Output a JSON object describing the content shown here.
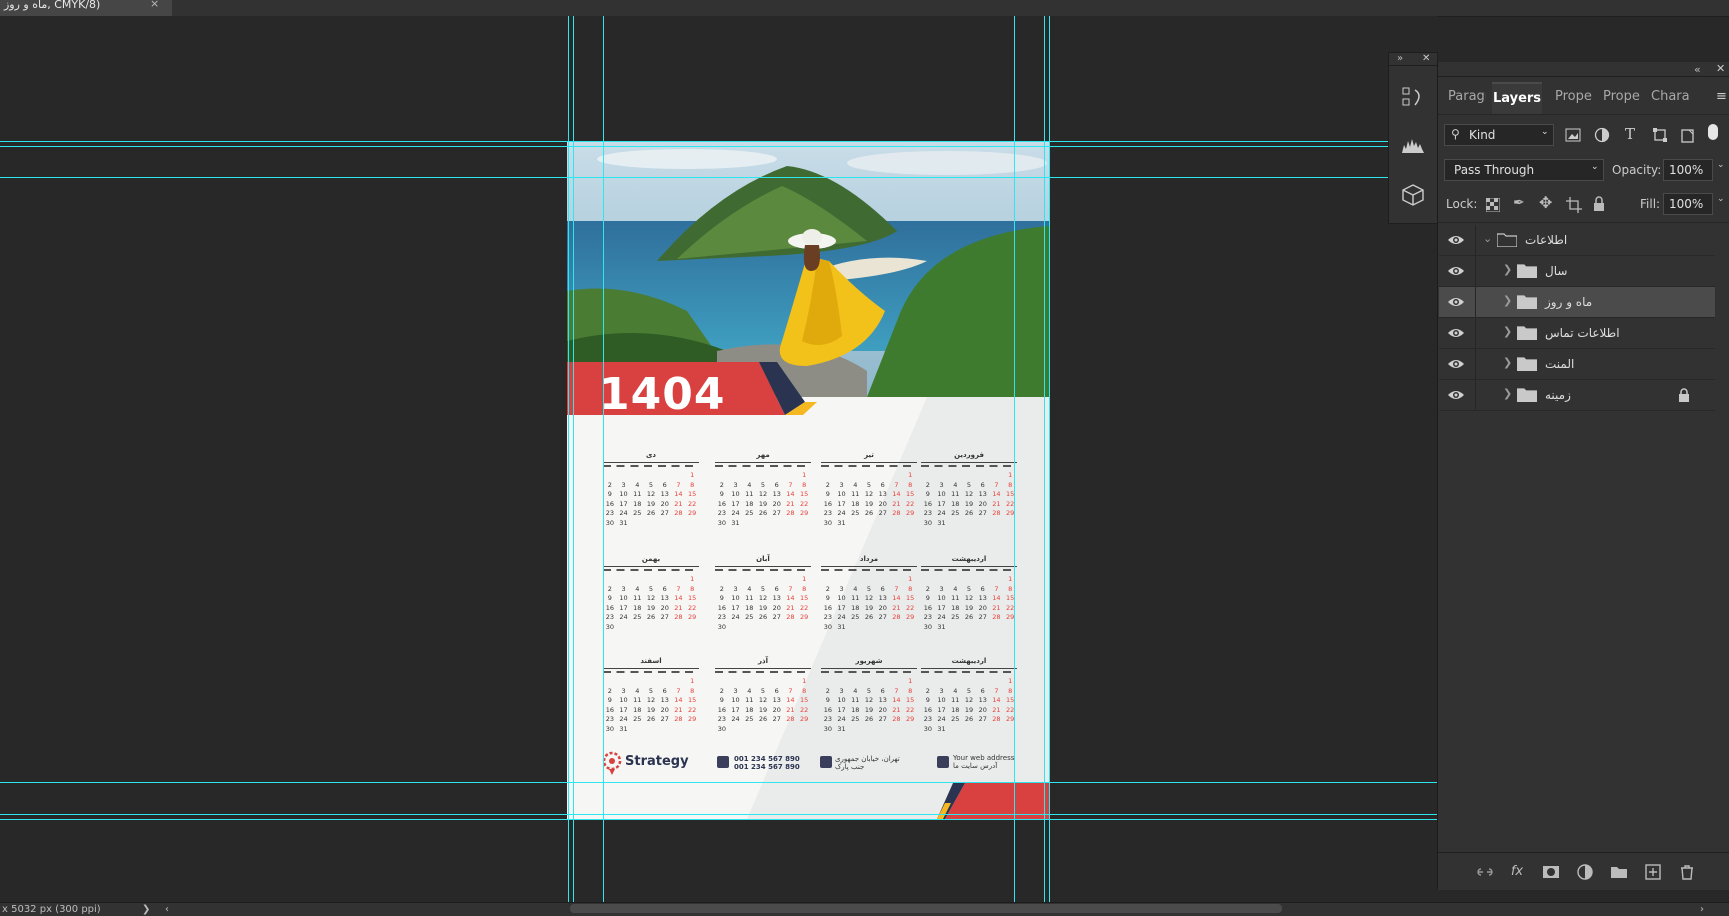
{
  "document_tab": {
    "title": "ماه و روز, CMYK/8)",
    "close": "×"
  },
  "poster": {
    "year": "1404",
    "months": [
      {
        "name": "فروردین",
        "days": [
          "",
          "",
          "",
          "",
          "",
          "",
          "1",
          "2",
          "3",
          "4",
          "5",
          "6",
          "7",
          "8",
          "9",
          "10",
          "11",
          "12",
          "13",
          "14",
          "15",
          "16",
          "17",
          "18",
          "19",
          "20",
          "21",
          "22",
          "23",
          "24",
          "25",
          "26",
          "27",
          "28",
          "29",
          "30",
          "31"
        ]
      },
      {
        "name": "تیر",
        "days": [
          "",
          "",
          "",
          "",
          "",
          "",
          "1",
          "2",
          "3",
          "4",
          "5",
          "6",
          "7",
          "8",
          "9",
          "10",
          "11",
          "12",
          "13",
          "14",
          "15",
          "16",
          "17",
          "18",
          "19",
          "20",
          "21",
          "22",
          "23",
          "24",
          "25",
          "26",
          "27",
          "28",
          "29",
          "30",
          "31"
        ]
      },
      {
        "name": "مهر",
        "days": [
          "",
          "",
          "",
          "",
          "",
          "",
          "1",
          "2",
          "3",
          "4",
          "5",
          "6",
          "7",
          "8",
          "9",
          "10",
          "11",
          "12",
          "13",
          "14",
          "15",
          "16",
          "17",
          "18",
          "19",
          "20",
          "21",
          "22",
          "23",
          "24",
          "25",
          "26",
          "27",
          "28",
          "29",
          "30",
          "31"
        ]
      },
      {
        "name": "دی",
        "days": [
          "",
          "",
          "",
          "",
          "",
          "",
          "1",
          "2",
          "3",
          "4",
          "5",
          "6",
          "7",
          "8",
          "9",
          "10",
          "11",
          "12",
          "13",
          "14",
          "15",
          "16",
          "17",
          "18",
          "19",
          "20",
          "21",
          "22",
          "23",
          "24",
          "25",
          "26",
          "27",
          "28",
          "29",
          "30",
          "31"
        ]
      },
      {
        "name": "اردیبهشت",
        "days": [
          "",
          "",
          "",
          "",
          "",
          "",
          "1",
          "2",
          "3",
          "4",
          "5",
          "6",
          "7",
          "8",
          "9",
          "10",
          "11",
          "12",
          "13",
          "14",
          "15",
          "16",
          "17",
          "18",
          "19",
          "20",
          "21",
          "22",
          "23",
          "24",
          "25",
          "26",
          "27",
          "28",
          "29",
          "30",
          "31"
        ]
      },
      {
        "name": "مرداد",
        "days": [
          "",
          "",
          "",
          "",
          "",
          "",
          "1",
          "2",
          "3",
          "4",
          "5",
          "6",
          "7",
          "8",
          "9",
          "10",
          "11",
          "12",
          "13",
          "14",
          "15",
          "16",
          "17",
          "18",
          "19",
          "20",
          "21",
          "22",
          "23",
          "24",
          "25",
          "26",
          "27",
          "28",
          "29",
          "30",
          "31"
        ]
      },
      {
        "name": "آبان",
        "days": [
          "",
          "",
          "",
          "",
          "",
          "",
          "1",
          "2",
          "3",
          "4",
          "5",
          "6",
          "7",
          "8",
          "9",
          "10",
          "11",
          "12",
          "13",
          "14",
          "15",
          "16",
          "17",
          "18",
          "19",
          "20",
          "21",
          "22",
          "23",
          "24",
          "25",
          "26",
          "27",
          "28",
          "29",
          "30"
        ]
      },
      {
        "name": "بهمن",
        "days": [
          "",
          "",
          "",
          "",
          "",
          "",
          "1",
          "2",
          "3",
          "4",
          "5",
          "6",
          "7",
          "8",
          "9",
          "10",
          "11",
          "12",
          "13",
          "14",
          "15",
          "16",
          "17",
          "18",
          "19",
          "20",
          "21",
          "22",
          "23",
          "24",
          "25",
          "26",
          "27",
          "28",
          "29",
          "30"
        ]
      },
      {
        "name": "اردیبهشت",
        "days": [
          "",
          "",
          "",
          "",
          "",
          "",
          "1",
          "2",
          "3",
          "4",
          "5",
          "6",
          "7",
          "8",
          "9",
          "10",
          "11",
          "12",
          "13",
          "14",
          "15",
          "16",
          "17",
          "18",
          "19",
          "20",
          "21",
          "22",
          "23",
          "24",
          "25",
          "26",
          "27",
          "28",
          "29",
          "30",
          "31"
        ]
      },
      {
        "name": "شهریور",
        "days": [
          "",
          "",
          "",
          "",
          "",
          "",
          "1",
          "2",
          "3",
          "4",
          "5",
          "6",
          "7",
          "8",
          "9",
          "10",
          "11",
          "12",
          "13",
          "14",
          "15",
          "16",
          "17",
          "18",
          "19",
          "20",
          "21",
          "22",
          "23",
          "24",
          "25",
          "26",
          "27",
          "28",
          "29",
          "30",
          "31"
        ]
      },
      {
        "name": "آذر",
        "days": [
          "",
          "",
          "",
          "",
          "",
          "",
          "1",
          "2",
          "3",
          "4",
          "5",
          "6",
          "7",
          "8",
          "9",
          "10",
          "11",
          "12",
          "13",
          "14",
          "15",
          "16",
          "17",
          "18",
          "19",
          "20",
          "21",
          "22",
          "23",
          "24",
          "25",
          "26",
          "27",
          "28",
          "29",
          "30"
        ]
      },
      {
        "name": "اسفند",
        "days": [
          "",
          "",
          "",
          "",
          "",
          "",
          "1",
          "2",
          "3",
          "4",
          "5",
          "6",
          "7",
          "8",
          "9",
          "10",
          "11",
          "12",
          "13",
          "14",
          "15",
          "16",
          "17",
          "18",
          "19",
          "20",
          "21",
          "22",
          "23",
          "24",
          "25",
          "26",
          "27",
          "28",
          "29",
          "30",
          "31"
        ]
      }
    ],
    "footer": {
      "brand": "Strategy",
      "phone1": "001 234 567 890",
      "phone2": "001 234 567 890",
      "address1": "تهران، خیابان جمهوری",
      "address2": "جنب پارک",
      "web1": "Your web address",
      "web2": "آدرس سایت ما"
    }
  },
  "status_bar": {
    "doc_info": "x 5032 px (300 ppi)",
    "arrow": "❯",
    "scroll_left": "‹",
    "scroll_right": "›"
  },
  "panel": {
    "collapse": "«",
    "close": "✕",
    "tabs": [
      "Paragr",
      "Layers",
      "Prope",
      "Prope",
      "Charac"
    ],
    "active_tab": "Layers",
    "menu": "≡",
    "filter": {
      "label": "Kind"
    },
    "blend_mode": "Pass Through",
    "opacity_label": "Opacity:",
    "opacity_value": "100%",
    "lock_label": "Lock:",
    "fill_label": "Fill:",
    "fill_value": "100%",
    "layers": [
      {
        "name": "اطلاعات",
        "expanded": true,
        "locked": false,
        "selected": false,
        "level": 0
      },
      {
        "name": "سال",
        "expanded": false,
        "locked": false,
        "selected": false,
        "level": 1
      },
      {
        "name": "ماه و روز",
        "expanded": false,
        "locked": false,
        "selected": true,
        "level": 1
      },
      {
        "name": "اطلاعات تماس",
        "expanded": false,
        "locked": false,
        "selected": false,
        "level": 1
      },
      {
        "name": "المنت",
        "expanded": false,
        "locked": false,
        "selected": false,
        "level": 1
      },
      {
        "name": "زمینه",
        "expanded": false,
        "locked": true,
        "selected": false,
        "level": 1
      }
    ],
    "bottom_fx": "fx"
  },
  "mini_panel": {
    "collapse": "»",
    "close": "✕"
  },
  "colors": {
    "guide": "#2ee6f0",
    "accent_red": "#d8413f",
    "accent_yellow": "#f5b820",
    "panel_bg": "#323232",
    "canvas_bg": "#282828"
  }
}
